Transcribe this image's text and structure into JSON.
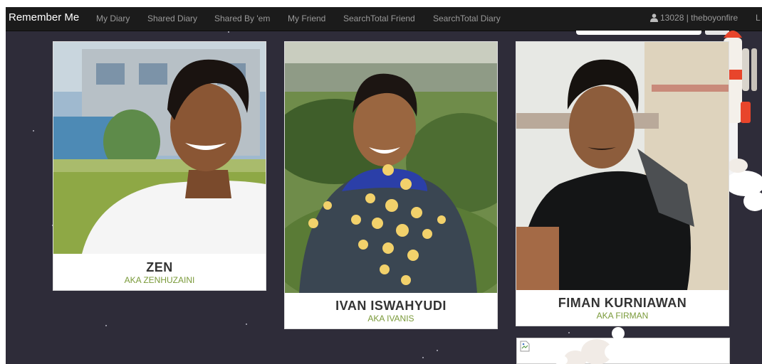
{
  "navbar": {
    "brand": "Remember Me",
    "links": [
      "My Diary",
      "Shared Diary",
      "Shared By 'em",
      "My Friend",
      "SearchTotal Friend",
      "SearchTotal Diary"
    ],
    "user_label": "13028 | theboyonfire",
    "overflow_link": "L"
  },
  "friends": [
    {
      "name": "ZEN",
      "aka": "AKA ZENHUZAINI"
    },
    {
      "name": "IVAN ISWAHYUDI",
      "aka": "AKA IVANIS"
    },
    {
      "name": "FIMAN KURNIAWAN",
      "aka": "AKA FIRMAN"
    }
  ],
  "colors": {
    "background": "#2e2c39",
    "navbar": "#1b1b1b",
    "nav_text": "#999999",
    "aka_text": "#7a9a3a",
    "name_text": "#333333"
  },
  "icons": {
    "user": "user-icon",
    "broken_image": "broken-image-icon"
  }
}
